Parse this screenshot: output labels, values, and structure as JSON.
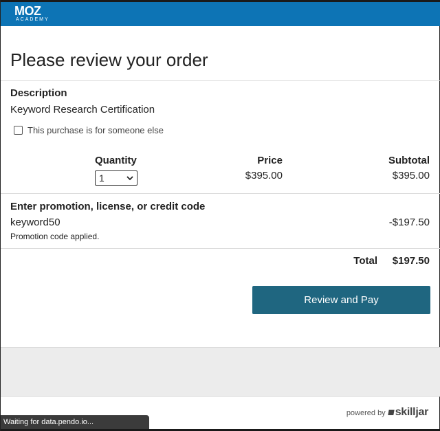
{
  "header": {
    "brand": "MOZ",
    "sub_brand": "ACADEMY",
    "bg_color": "#0d74b5"
  },
  "page": {
    "title": "Please review your order"
  },
  "order": {
    "description_heading": "Description",
    "product_name": "Keyword Research Certification",
    "someone_else_label": "This purchase is for someone else",
    "someone_else_checked": false,
    "quantity_heading": "Quantity",
    "price_heading": "Price",
    "subtotal_heading": "Subtotal",
    "quantity_value": "1",
    "price_value": "$395.00",
    "subtotal_value": "$395.00"
  },
  "promo": {
    "heading": "Enter promotion, license, or credit code",
    "code": "keyword50",
    "discount": "-$197.50",
    "status": "Promotion code applied."
  },
  "total": {
    "label": "Total",
    "value": "$197.50"
  },
  "actions": {
    "pay_label": "Review and Pay",
    "pay_color": "#1f6680"
  },
  "footer": {
    "powered_by": "powered by",
    "brand": "skilljar"
  },
  "browser_status": {
    "text": "Waiting for data.pendo.io..."
  },
  "icons": {
    "dropdown": "chevron-down-icon",
    "checkbox": "checkbox-icon",
    "skilljar_mark": "skilljar-logo-icon"
  }
}
